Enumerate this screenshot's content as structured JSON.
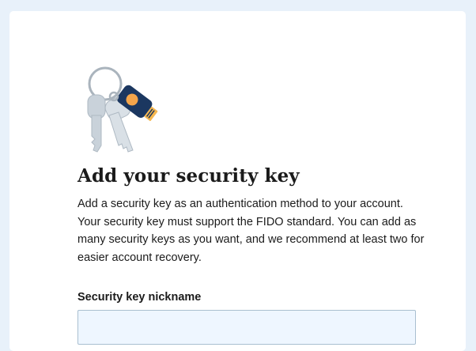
{
  "page": {
    "title": "Add your security key",
    "description": "Add a security key as an authentication method to your account. Your security key must support the FIDO standard. You can add as many security keys as you want, and we recommend at least two for easier account recovery."
  },
  "form": {
    "nickname_label": "Security key nickname",
    "nickname_value": "",
    "nickname_placeholder": ""
  },
  "illustration": {
    "icon": "security-key-on-keyring-icon",
    "colors": {
      "key_silver": "#c9d2da",
      "fob_navy": "#1b3760",
      "fob_orange": "#f4a54b",
      "connector_gold": "#f5b74f"
    }
  },
  "colors": {
    "background": "#e8f1fa",
    "card": "#ffffff",
    "input_bg": "#eef6ff",
    "input_border": "#a9bfd0",
    "text": "#1b1b1b"
  }
}
